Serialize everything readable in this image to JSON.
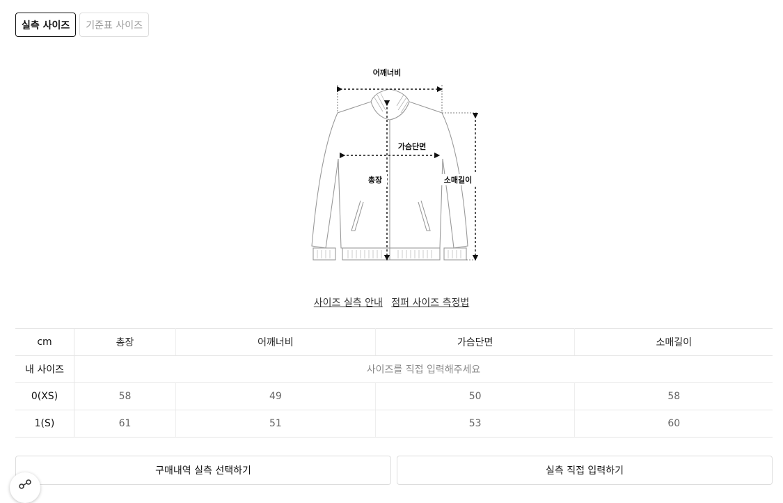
{
  "tabs": {
    "actual": "실측 사이즈",
    "standard": "기준표 사이즈"
  },
  "diagram": {
    "shoulder": "어깨너비",
    "chest": "가슴단면",
    "length": "총장",
    "sleeve": "소매길이"
  },
  "guides": {
    "actual_guide": "사이즈 실측 안내",
    "jumper_measure": "점퍼 사이즈 측정법"
  },
  "table": {
    "unit": "cm",
    "headers": [
      "총장",
      "어깨너비",
      "가슴단면",
      "소매길이"
    ],
    "my_size_label": "내 사이즈",
    "my_size_placeholder": "사이즈를 직접 입력해주세요",
    "rows": [
      {
        "size": "0(XS)",
        "values": [
          "58",
          "49",
          "50",
          "58"
        ]
      },
      {
        "size": "1(S)",
        "values": [
          "61",
          "51",
          "53",
          "60"
        ]
      }
    ]
  },
  "buttons": {
    "purchase": "구매내역 실측 선택하기",
    "direct": "실측 직접 입력하기"
  },
  "icons": {
    "share": "share-icon"
  }
}
